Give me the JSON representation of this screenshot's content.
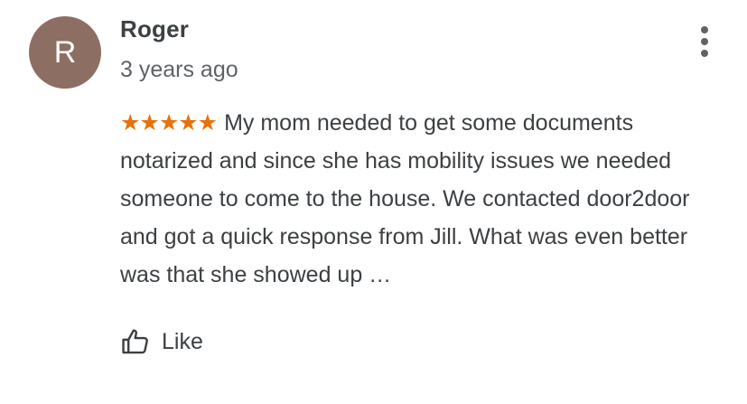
{
  "review": {
    "avatar_letter": "R",
    "avatar_color": "#8d6e63",
    "author": "Roger",
    "date": "3 years ago",
    "rating": 5,
    "stars_text": "★★★★★",
    "star_color": "#e8710a",
    "body": "My mom needed to get some documents notarized and since she has mobility issues we needed someone to come to the house.  We contacted door2door and got a quick response from Jill.  What was even better was that she showed up …",
    "like_label": "Like",
    "like_icon": "thumb-up-outline-icon",
    "more_icon": "more-vertical-icon"
  }
}
